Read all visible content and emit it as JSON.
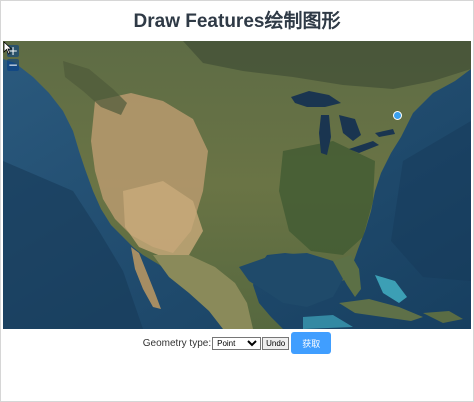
{
  "page": {
    "title": "Draw Features绘制图形"
  },
  "map": {
    "zoom_in_label": "+",
    "zoom_out_label": "−",
    "imagery": "satellite-north-america"
  },
  "controls": {
    "geometry_label": "Geometry type:",
    "geometry_selected": "Point",
    "undo_label": "Undo",
    "get_label": "获取"
  },
  "colors": {
    "title": "#2f3a46",
    "point_fill": "#3aa0ef",
    "get_button": "#409eff"
  }
}
